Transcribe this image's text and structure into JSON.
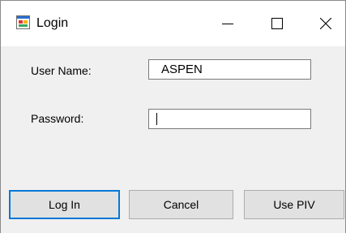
{
  "window": {
    "title": "Login",
    "icon": "application-form-icon",
    "controls": [
      "minimize-icon",
      "maximize-icon",
      "close-icon"
    ]
  },
  "form": {
    "username_label": "User Name:",
    "username_value": "ASPEN",
    "password_label": "Password:",
    "password_value": ""
  },
  "buttons": {
    "login": "Log In",
    "cancel": "Cancel",
    "use_piv": "Use PIV"
  },
  "colors": {
    "focus_accent": "#0078d7",
    "button_face": "#e1e1e1",
    "client_background": "#f0f0f0"
  }
}
